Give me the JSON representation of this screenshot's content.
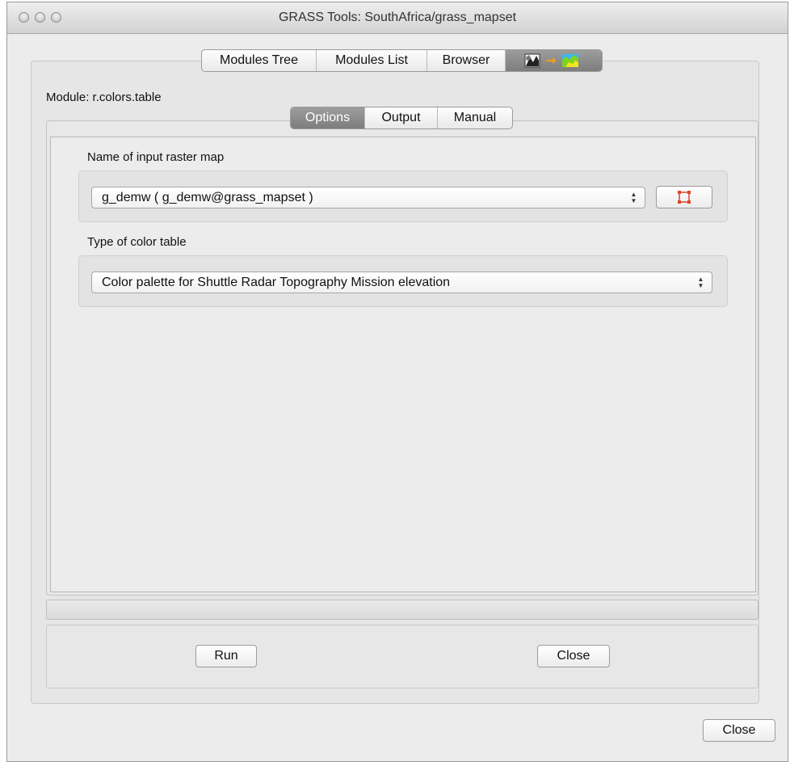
{
  "window": {
    "title": "GRASS Tools: SouthAfrica/grass_mapset"
  },
  "top_tabs": {
    "items": [
      {
        "label": "Modules Tree"
      },
      {
        "label": "Modules List"
      },
      {
        "label": "Browser"
      }
    ],
    "module_tab_icons": [
      "raster-map-icon",
      "arrow-right-icon",
      "colored-map-icon"
    ]
  },
  "module": {
    "label": "Module: r.colors.table"
  },
  "sub_tabs": {
    "items": [
      {
        "label": "Options",
        "selected": true
      },
      {
        "label": "Output",
        "selected": false
      },
      {
        "label": "Manual",
        "selected": false
      }
    ]
  },
  "options": {
    "input_raster": {
      "label": "Name of input raster map",
      "value": "g_demw ( g_demw@grass_mapset )"
    },
    "color_table": {
      "label": "Type of color table",
      "value": "Color palette for Shuttle Radar Topography Mission elevation"
    }
  },
  "actions": {
    "run_label": "Run",
    "close_label": "Close",
    "window_close_label": "Close"
  },
  "colors": {
    "selected_tab": "#8c8c8c",
    "select_extent_icon": "#d9472b"
  }
}
